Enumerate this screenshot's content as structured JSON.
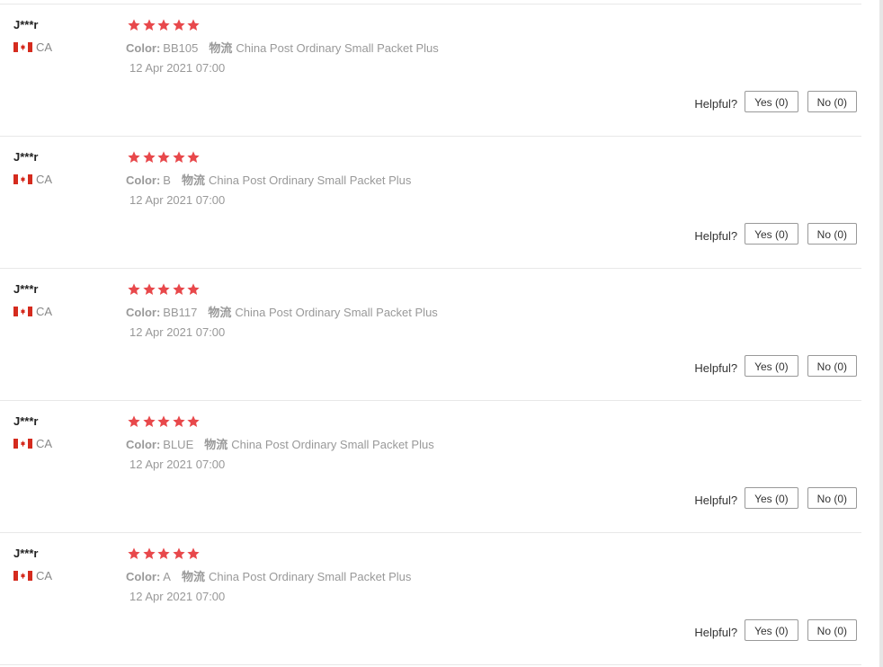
{
  "colors": {
    "star": "#e8484b",
    "divider": "#e8e8e8",
    "muted_text": "#999999"
  },
  "icons": {
    "star": "star-icon",
    "flag": "canada-flag-icon"
  },
  "reviews": [
    {
      "user": "J***r",
      "country": "CA",
      "rating": 5,
      "sku_label": "Color:",
      "sku_value": "BB105",
      "ship_label": "物流",
      "ship_value": "China Post Ordinary Small Packet Plus",
      "date": "12 Apr 2021 07:00",
      "helpful_label": "Helpful?",
      "yes_label": "Yes (0)",
      "no_label": "No (0)"
    },
    {
      "user": "J***r",
      "country": "CA",
      "rating": 5,
      "sku_label": "Color:",
      "sku_value": "B",
      "ship_label": "物流",
      "ship_value": "China Post Ordinary Small Packet Plus",
      "date": "12 Apr 2021 07:00",
      "helpful_label": "Helpful?",
      "yes_label": "Yes (0)",
      "no_label": "No (0)"
    },
    {
      "user": "J***r",
      "country": "CA",
      "rating": 5,
      "sku_label": "Color:",
      "sku_value": "BB117",
      "ship_label": "物流",
      "ship_value": "China Post Ordinary Small Packet Plus",
      "date": "12 Apr 2021 07:00",
      "helpful_label": "Helpful?",
      "yes_label": "Yes (0)",
      "no_label": "No (0)"
    },
    {
      "user": "J***r",
      "country": "CA",
      "rating": 5,
      "sku_label": "Color:",
      "sku_value": "BLUE",
      "ship_label": "物流",
      "ship_value": "China Post Ordinary Small Packet Plus",
      "date": "12 Apr 2021 07:00",
      "helpful_label": "Helpful?",
      "yes_label": "Yes (0)",
      "no_label": "No (0)"
    },
    {
      "user": "J***r",
      "country": "CA",
      "rating": 5,
      "sku_label": "Color:",
      "sku_value": "A",
      "ship_label": "物流",
      "ship_value": "China Post Ordinary Small Packet Plus",
      "date": "12 Apr 2021 07:00",
      "helpful_label": "Helpful?",
      "yes_label": "Yes (0)",
      "no_label": "No (0)"
    }
  ]
}
